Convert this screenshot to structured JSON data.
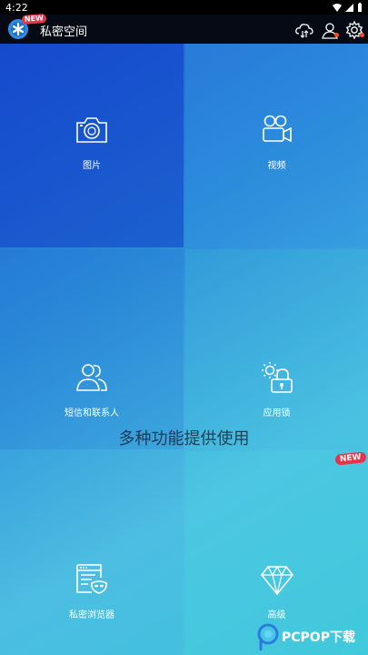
{
  "status_bar": {
    "time": "4:22"
  },
  "app_bar": {
    "title": "私密空间",
    "new_tag": "NEW"
  },
  "tiles": [
    {
      "label": "图片",
      "icon": "camera-icon"
    },
    {
      "label": "视频",
      "icon": "video-camera-icon"
    },
    {
      "label": "短信和联系人",
      "icon": "contacts-icon"
    },
    {
      "label": "应用锁",
      "icon": "app-lock-icon"
    },
    {
      "label": "私密浏览器",
      "icon": "private-browser-icon"
    },
    {
      "label": "高级",
      "icon": "diamond-icon"
    }
  ],
  "caption": "多种功能提供使用",
  "new_badge": "NEW",
  "watermark": "PCPOP下载"
}
